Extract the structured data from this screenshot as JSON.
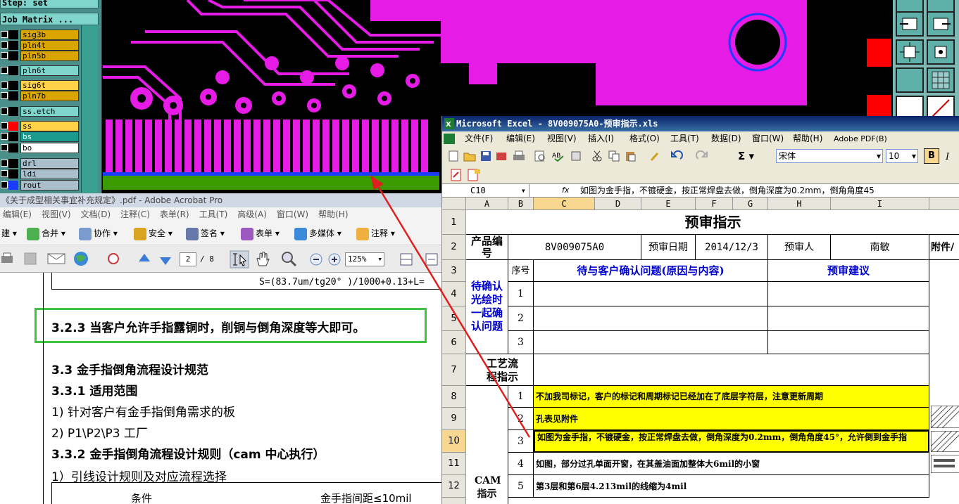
{
  "cam": {
    "step_label": "Step: set",
    "job_matrix_label": "Job Matrix ...",
    "layers": [
      {
        "name": "sig3b",
        "color": "#d9a500"
      },
      {
        "name": "pln4t",
        "color": "#d9a500"
      },
      {
        "name": "pln5b",
        "color": "#d9a500"
      },
      {
        "name": "pln6t",
        "color": "#7fd4cc"
      },
      {
        "name": "sig6t",
        "color": "#ffd24a"
      },
      {
        "name": "pln7b",
        "color": "#d9a500"
      },
      {
        "name": "ss.etch",
        "color": "#7fd4cc"
      },
      {
        "name": "ss",
        "color": "#ffd24a"
      },
      {
        "name": "bs",
        "color": "#1a9a8a"
      },
      {
        "name": "bo",
        "color": "#ffffff"
      },
      {
        "name": "drl",
        "color": "#a9bfcb"
      },
      {
        "name": "ldi",
        "color": "#a9bfcb"
      },
      {
        "name": "rout",
        "color": "#a9bfcb"
      }
    ]
  },
  "acrobat": {
    "title": "《关于成型相关事宜补充规定》.pdf - Adobe Acrobat Pro",
    "menu": [
      "编辑(E)",
      "视图(V)",
      "文档(D)",
      "注释(C)",
      "表单(R)",
      "工具(T)",
      "高级(A)",
      "窗口(W)",
      "帮助(H)"
    ],
    "toolbar1": [
      "建",
      "合并",
      "协作",
      "安全",
      "签名",
      "表单",
      "多媒体",
      "注释"
    ],
    "page_current": "2",
    "page_total": "/ 8",
    "zoom": "125%",
    "doc": {
      "formula": "S=(83.7um/tg20° )/1000+0.13+L=",
      "highlight": "3.2.3 当客户允许手指露铜时，削铜与倒角深度等大即可。",
      "h33": "3.3 金手指倒角流程设计规范",
      "h331": "3.3.1   适用范围",
      "item1": "1) 针对客户有金手指倒角需求的板",
      "item2": "2) P1\\P2\\P3 工厂",
      "h332": "3.3.2   金手指倒角流程设计规则（cam 中心执行）",
      "rule1": "1）引线设计规则及对应流程选择",
      "table_col1": "条件",
      "table_col2": "金手指间距≤10mil"
    }
  },
  "excel": {
    "title": "Microsoft Excel - 8V009075A0-预审指示.xls",
    "menu": [
      "文件(F)",
      "编辑(E)",
      "视图(V)",
      "插入(I)",
      "格式(O)",
      "工具(T)",
      "数据(D)",
      "窗口(W)",
      "帮助(H)",
      "Adobe PDF(B)"
    ],
    "font_name": "宋体",
    "font_size": "10",
    "bold_label": "B",
    "name_box": "C10",
    "fx": "fx",
    "formula": "如图为金手指，不镀硬金，按正常焊盘去做，倒角深度为0.2mm，倒角角度45",
    "columns": [
      "A",
      "B",
      "C",
      "D",
      "E",
      "F",
      "G",
      "H",
      "I"
    ],
    "rows": [
      "1",
      "2",
      "3",
      "4",
      "5",
      "6",
      "7",
      "8",
      "9",
      "10",
      "11",
      "12"
    ],
    "sheet": {
      "title": "预审指示",
      "product_no_label": "产品编号",
      "product_no": "8V009075A0",
      "review_date_label": "预审日期",
      "review_date": "2014/12/3",
      "reviewer_label": "预审人",
      "reviewer": "南敏",
      "attachment_label": "附件/",
      "confirm_label": "待确认光绘时一起确认问题",
      "seq_label": "序号",
      "question_header": "待与客户确认问题(原因与内容)",
      "suggestion_header": "预审建议",
      "process_label": "工艺流程指示",
      "cam_label": "CAM指示",
      "items": [
        {
          "no": "1",
          "text": "不加我司标记，客户的标记和周期标记已经加在了底层字符层，注意更新周期",
          "yellow": true
        },
        {
          "no": "2",
          "text": "孔表见附件",
          "yellow": true
        },
        {
          "no": "3",
          "text": "如图为金手指，不镀硬金，按正常焊盘去做，倒角深度为0.2mm，倒角角度45°，允许倒到金手指",
          "yellow": true
        },
        {
          "no": "4",
          "text": "如图，部分过孔单面开窗，在其盖油面加整体大6mil的小窗",
          "yellow": false
        },
        {
          "no": "5",
          "text": "第3层和第6层4.213mil的线缩为4mil",
          "yellow": false
        }
      ],
      "q_nums": [
        "1",
        "2",
        "3"
      ]
    }
  },
  "colors": {
    "pcb_copper": "#e61be6",
    "highlight_green": "#3ec43e",
    "arrow": "#e02020"
  }
}
